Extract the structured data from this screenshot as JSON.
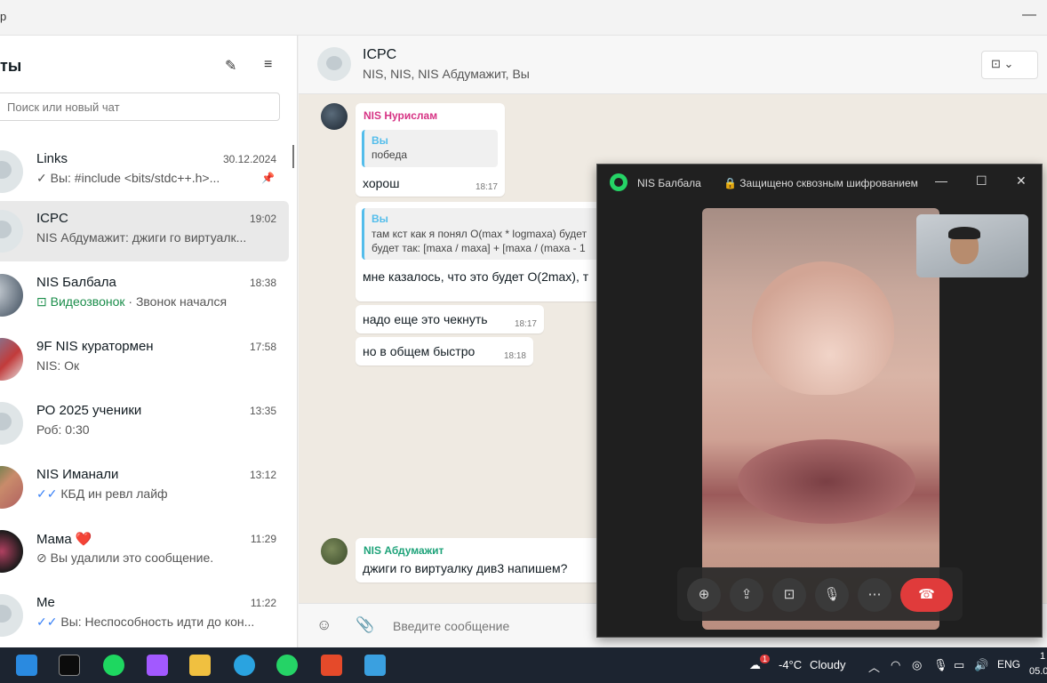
{
  "window": {
    "title_fragment": "р"
  },
  "sidebar": {
    "title": "ты",
    "search_placeholder": "Поиск или новый чат",
    "chats": [
      {
        "name": "Links",
        "time": "30.12.2024",
        "preview": "✓ Вы:  #include <bits/stdc++.h>...",
        "pinned": true
      },
      {
        "name": "ICPC",
        "time": "19:02",
        "preview": "NIS Абдумажит: джиги го виртуалк...",
        "selected": true
      },
      {
        "name": "NIS Балбала",
        "time": "18:38",
        "call_label": "Видеозвонок",
        "preview_rest": "· Звонок начался"
      },
      {
        "name": "9F NIS куратормен",
        "time": "17:58",
        "preview": "NIS: Ок"
      },
      {
        "name": "РО 2025 ученики",
        "time": "13:35",
        "preview": "Роб:  0:30"
      },
      {
        "name": "NIS Иманали",
        "time": "13:12",
        "preview": "КБД ин ревл лайф"
      },
      {
        "name": "Мама ❤️",
        "time": "11:29",
        "preview": "Вы удалили это сообщение."
      },
      {
        "name": "Me",
        "time": "11:22",
        "preview": "Вы: Неспособность идти до кон..."
      }
    ]
  },
  "chat": {
    "title": "ICPC",
    "members": "NIS, NIS, NIS Абдумажит, Вы",
    "composer_placeholder": "Введите сообщение",
    "messages": [
      {
        "sender": "NIS Нурислам",
        "sender_color": "#d63384",
        "quote_name": "Вы",
        "quote_lines": [
          "победа"
        ],
        "text": "хорош",
        "time": "18:17"
      },
      {
        "quote_name": "Вы",
        "quote_lines": [
          "там кст как я понял O(max * logmaxa) будет",
          "будет так: [maxa / maxa] + [maxa / (maxa - 1"
        ],
        "text": "мне казалось, что это будет O(2max), т"
      },
      {
        "text": "надо еще это чекнуть",
        "time": "18:17"
      },
      {
        "text": "но в общем быстро",
        "time": "18:18"
      },
      {
        "sender": "NIS Абдумажит",
        "sender_color": "#1fa37a",
        "text": "джиги го виртуалку див3 напишем?"
      }
    ]
  },
  "call": {
    "contact": "NIS Балбала",
    "encryption": "Защищено сквозным шифрованием"
  },
  "taskbar": {
    "temperature": "-4°C",
    "weather": "Cloudy",
    "weather_badge": "1",
    "lang": "ENG",
    "clock_top": "1",
    "clock_bottom": "05.0"
  }
}
